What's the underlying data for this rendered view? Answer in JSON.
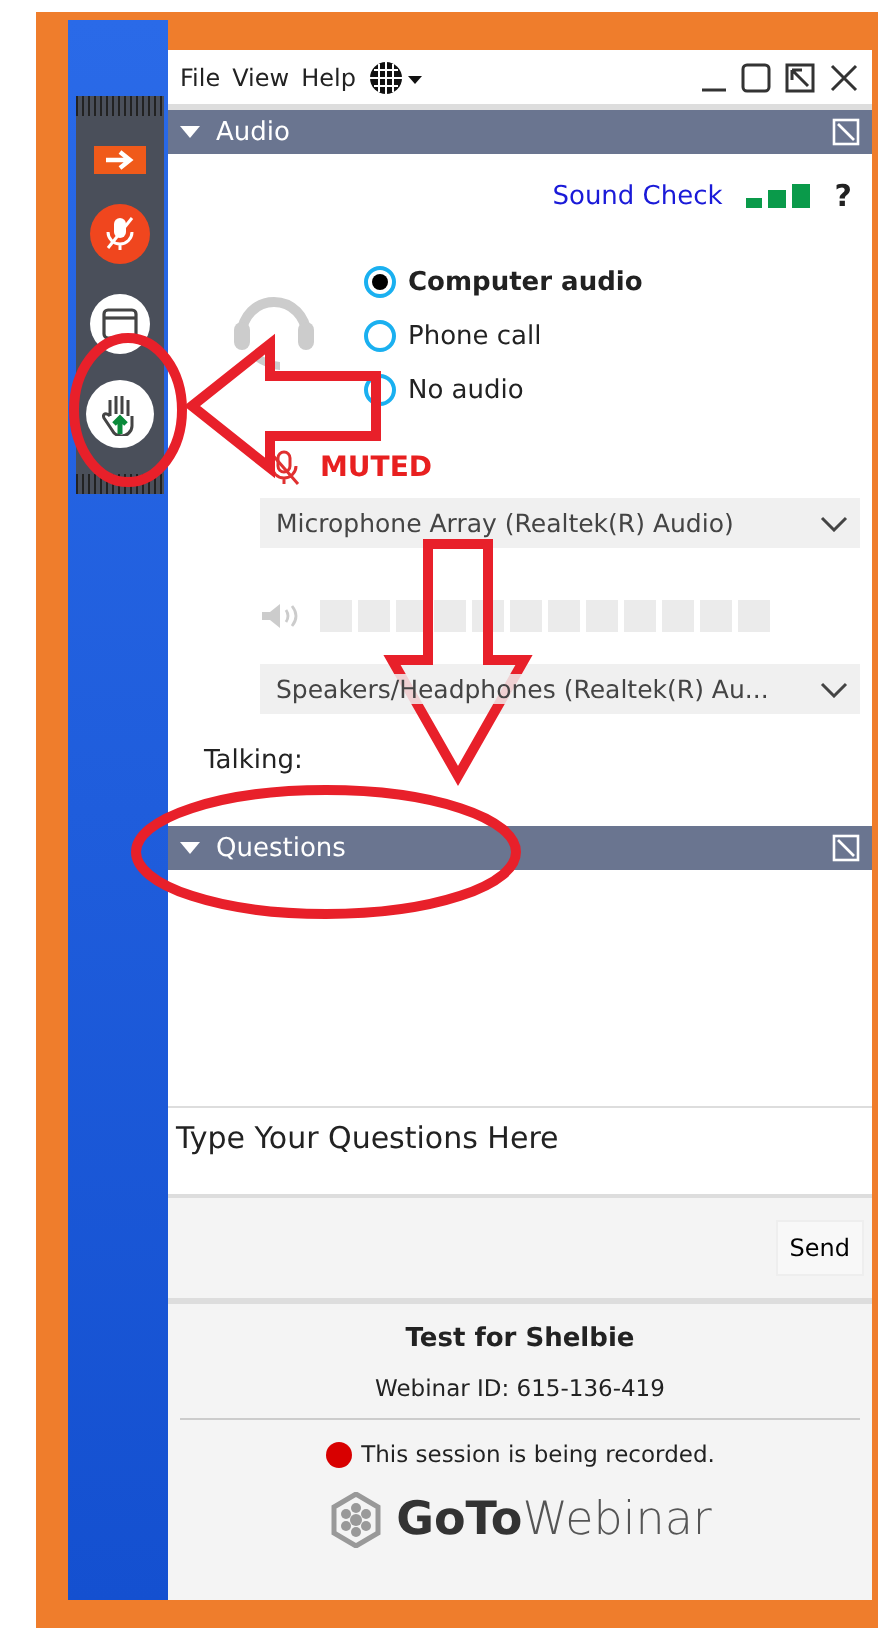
{
  "sidebar": {
    "items": [
      {
        "kind": "arrow",
        "selected": false
      },
      {
        "kind": "mic",
        "selected": false
      },
      {
        "kind": "window",
        "selected": false
      },
      {
        "kind": "hand",
        "selected": true
      }
    ]
  },
  "menu": [
    "File",
    "View",
    "Help"
  ],
  "audio": {
    "title": "Audio",
    "sound_check": "Sound Check",
    "help": "?",
    "options": [
      {
        "label": "Computer audio",
        "selected": true
      },
      {
        "label": "Phone call",
        "selected": false
      },
      {
        "label": "No audio",
        "selected": false
      }
    ],
    "mic_status": "MUTED",
    "microphone": "Microphone Array (Realtek(R) Audio)",
    "speakers": "Speakers/Headphones (Realtek(R) Au...",
    "talking": "Talking:"
  },
  "questions": {
    "title": "Questions",
    "placeholder": "Type Your Questions Here",
    "send": "Send"
  },
  "footer": {
    "title": "Test for Shelbie",
    "webinar_id": "Webinar ID: 615-136-419",
    "recording": "This session is being recorded.",
    "logo_bold": "GoTo",
    "logo_light": "Webinar"
  }
}
